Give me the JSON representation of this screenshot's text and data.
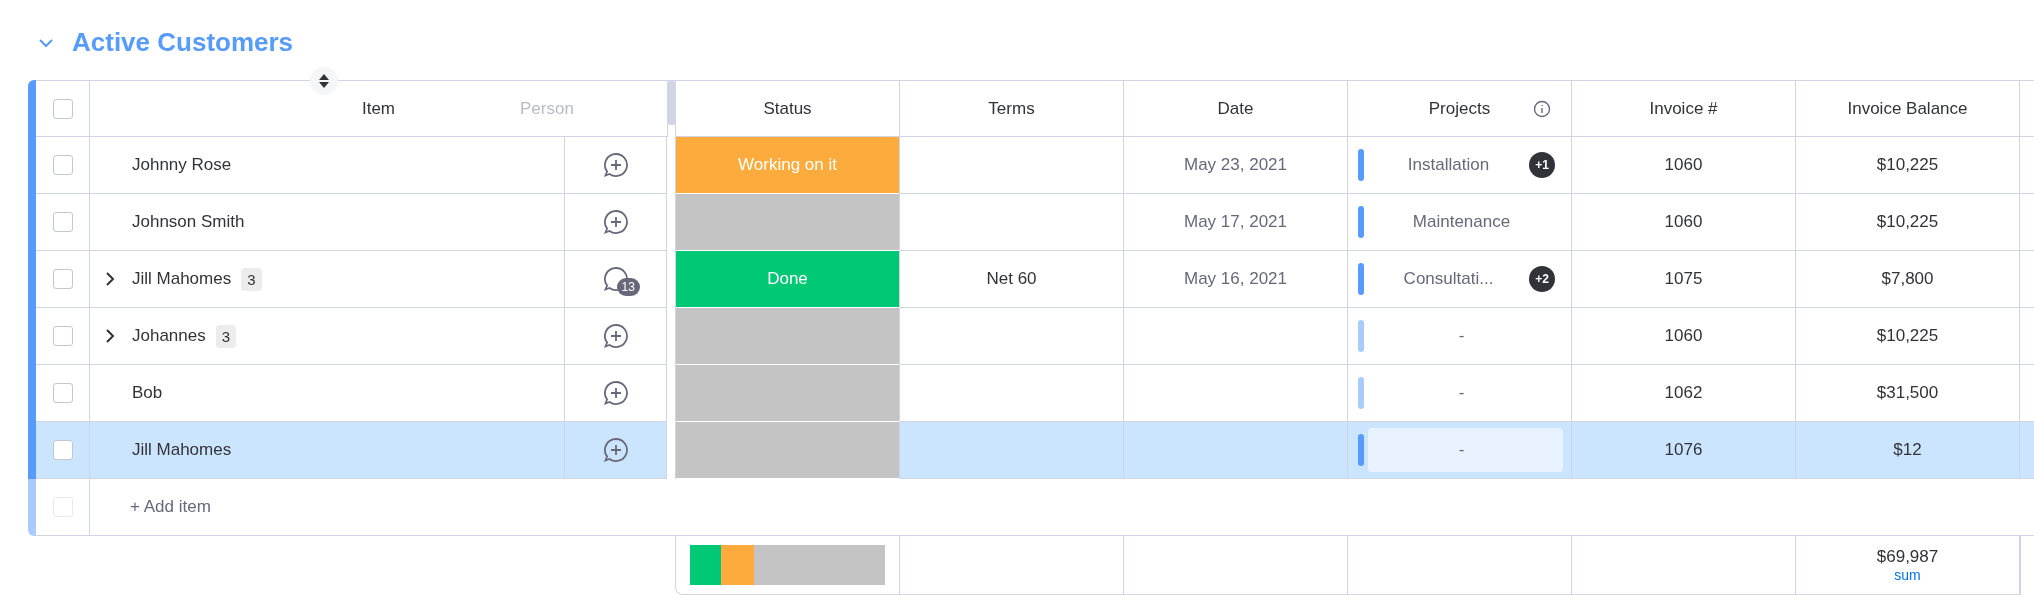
{
  "group": {
    "title": "Active Customers",
    "expanded": true
  },
  "select_all": {
    "checked": false
  },
  "columns": {
    "item": "Item",
    "person": "Person",
    "status": "Status",
    "terms": "Terms",
    "date": "Date",
    "projects": "Projects",
    "invoice": "Invoice #",
    "balance": "Invoice Balance"
  },
  "rows": [
    {
      "name": "Johnny Rose",
      "expandable": false,
      "status": {
        "label": "Working on it",
        "color": "#fdab3d"
      },
      "date": "May 23, 2021",
      "project": {
        "label": "Installation",
        "extra": "+1",
        "color": "#579bfc"
      },
      "invoice": "1060",
      "balance": "$10,225",
      "selected": false,
      "checked": false
    },
    {
      "name": "Johnson Smith",
      "expandable": false,
      "status": {
        "color": "#c4c4c4"
      },
      "date": "May 17, 2021",
      "project": {
        "label": "Maintenance",
        "color": "#579bfc"
      },
      "invoice": "1060",
      "balance": "$10,225",
      "selected": false,
      "checked": false
    },
    {
      "name": "Jill Mahomes",
      "expandable": true,
      "subitems": "3",
      "updates": "13",
      "status": {
        "label": "Done",
        "color": "#00c875"
      },
      "terms": "Net 60",
      "date": "May 16, 2021",
      "project": {
        "label": "Consultati...",
        "extra": "+2",
        "color": "#579bfc"
      },
      "invoice": "1075",
      "balance": "$7,800",
      "selected": false,
      "checked": false
    },
    {
      "name": "Johannes",
      "expandable": true,
      "subitems": "3",
      "status": {
        "color": "#c4c4c4"
      },
      "project": {
        "label": "-",
        "color": "#a9cdfb"
      },
      "invoice": "1060",
      "balance": "$10,225",
      "selected": false,
      "checked": false
    },
    {
      "name": "Bob",
      "expandable": false,
      "status": {
        "color": "#c4c4c4"
      },
      "project": {
        "label": "-",
        "color": "#a9cdfb"
      },
      "invoice": "1062",
      "balance": "$31,500",
      "selected": false,
      "checked": false
    },
    {
      "name": "Jill Mahomes",
      "expandable": false,
      "status": {
        "color": "#c4c4c4"
      },
      "project": {
        "label": "-",
        "color": "#579bfc"
      },
      "invoice": "1076",
      "balance": "$12",
      "selected": true,
      "checked": false
    }
  ],
  "add_item": {
    "label": "+ Add item",
    "checked": false
  },
  "footer": {
    "status_summary": [
      {
        "color": "#00c875",
        "level": 0.16
      },
      {
        "color": "#fdab3d",
        "level": 0.17
      },
      {
        "color": "#c4c4c4",
        "level": 0.67
      }
    ],
    "balance_total": "$69,987",
    "balance_function": "sum"
  }
}
